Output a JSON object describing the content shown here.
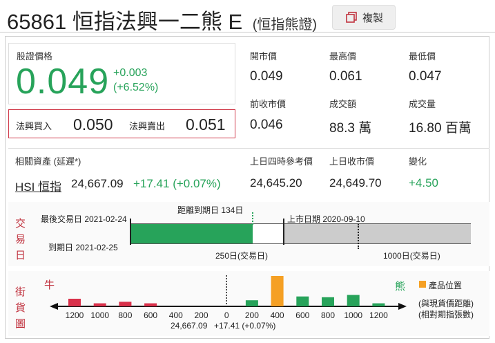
{
  "header": {
    "code": "65861",
    "name": "恒指法興一二熊 E",
    "type_label": "(恒指熊證)",
    "copy_label": "複製",
    "copy_icon": "copy-icon"
  },
  "price": {
    "label": "股證價格",
    "value": "0.049",
    "change": "+0.003",
    "change_pct": "(+6.52%)"
  },
  "bidask": {
    "bid_label": "法興買入",
    "bid_value": "0.050",
    "ask_label": "法興賣出",
    "ask_value": "0.051"
  },
  "stats": {
    "open_label": "開市價",
    "open": "0.049",
    "high_label": "最高價",
    "high": "0.061",
    "low_label": "最低價",
    "low": "0.047",
    "prev_label": "前收市價",
    "prev": "0.046",
    "turnover_label": "成交額",
    "turnover": "88.3 萬",
    "volume_label": "成交量",
    "volume": "16.80 百萬"
  },
  "underlying": {
    "label": "相關資產 (延遲*)",
    "name": "HSI 恒指",
    "price": "24,667.09",
    "change": "+17.41 (+0.07%)",
    "ref_label": "上日四時參考價",
    "ref_value": "24,645.20",
    "close_label": "上日收市價",
    "close_value": "24,649.70",
    "diff_label": "變化",
    "diff_value": "+4.50"
  },
  "timeline": {
    "side_title": [
      "交",
      "易",
      "日"
    ],
    "last_trade": "最後交易日 2021-02-24",
    "days_to_expiry": "距離到期日 134日",
    "listing_date": "上市日期 2020-09-10",
    "expiry": "到期日 2021-02-25",
    "tick_250": "250日(交易日)",
    "tick_1000": "1000日(交易日)",
    "progress_days_remaining": 134
  },
  "street": {
    "side_title": [
      "街",
      "貨",
      "圖"
    ],
    "bull_label": "牛",
    "bear_label": "熊",
    "legend_label": "產品位置",
    "note1": "(與現貨價距離)",
    "note2": "(相對期指張數)",
    "index_value": "24,667.09",
    "index_change": "+17.41 (+0.07%)"
  },
  "chart_data": {
    "type": "bar",
    "categories": [
      "1200",
      "1000",
      "800",
      "600",
      "400",
      "200",
      "0",
      "200",
      "400",
      "600",
      "800",
      "1000",
      "1200"
    ],
    "bull_values": [
      10,
      4,
      6,
      4,
      0,
      0,
      0,
      0,
      0,
      0,
      0,
      0,
      0
    ],
    "bear_values": [
      0,
      0,
      0,
      0,
      0,
      0,
      0,
      8,
      40,
      13,
      12,
      15,
      4
    ],
    "highlight_index": 8,
    "colors": {
      "bull": "#d9304a",
      "bear": "#27a35a",
      "highlight": "#f5a024"
    }
  }
}
